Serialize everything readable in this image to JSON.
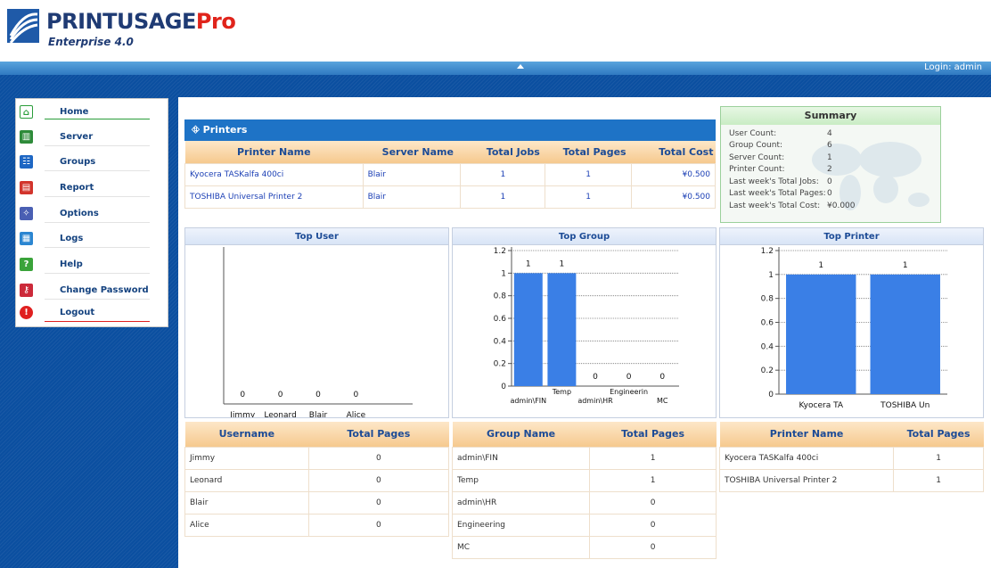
{
  "brand": {
    "name_main": "PRINTUSAGE",
    "name_pro": "Pro",
    "edition": "Enterprise 4.0"
  },
  "topbar": {
    "login": "Login: admin"
  },
  "menu": [
    {
      "label": "Home",
      "icon": "home-icon",
      "color": "#2a9d3a"
    },
    {
      "label": "Server",
      "icon": "server-icon",
      "color": "#2e8b3a"
    },
    {
      "label": "Groups",
      "icon": "groups-icon",
      "color": "#1e67c4"
    },
    {
      "label": "Report",
      "icon": "report-icon",
      "color": "#d2342c"
    },
    {
      "label": "Options",
      "icon": "options-icon",
      "color": "#4a5fb3"
    },
    {
      "label": "Logs",
      "icon": "logs-icon",
      "color": "#2b86d1"
    },
    {
      "label": "Help",
      "icon": "help-icon",
      "color": "#3aa33a"
    },
    {
      "label": "Change Password",
      "icon": "key-icon",
      "color": "#cc2a3a"
    },
    {
      "label": "Logout",
      "icon": "logout-icon",
      "color": "#e02020"
    }
  ],
  "printers": {
    "title": "Printers",
    "headers": [
      "Printer Name",
      "Server Name",
      "Total Jobs",
      "Total Pages",
      "Total Cost"
    ],
    "rows": [
      [
        "Kyocera TASKalfa 400ci",
        "Blair",
        "1",
        "1",
        "¥0.500"
      ],
      [
        "TOSHIBA Universal Printer 2",
        "Blair",
        "1",
        "1",
        "¥0.500"
      ]
    ]
  },
  "summary": {
    "title": "Summary",
    "items": [
      {
        "label": "User Count:",
        "value": "4"
      },
      {
        "label": "Group Count:",
        "value": "6"
      },
      {
        "label": "Server Count:",
        "value": "1"
      },
      {
        "label": "Printer Count:",
        "value": "2"
      },
      {
        "label": "Last week's Total Jobs:",
        "value": "0"
      },
      {
        "label": "Last week's Total Pages:",
        "value": "0"
      },
      {
        "label": "Last week's Total Cost:",
        "value": "¥0.000"
      }
    ]
  },
  "chart_data": [
    {
      "type": "bar",
      "title": "Top User",
      "categories": [
        "Jimmy",
        "Leonard",
        "Blair",
        "Alice"
      ],
      "values": [
        0,
        0,
        0,
        0
      ]
    },
    {
      "type": "bar",
      "title": "Top Group",
      "categories": [
        "admin\\FIN",
        "Temp",
        "admin\\HR",
        "Engineerin",
        "MC"
      ],
      "values": [
        1,
        1,
        0,
        0,
        0
      ],
      "ylim": [
        0,
        1.2
      ],
      "yticks": [
        "0",
        "0.2",
        "0.4",
        "0.6",
        "0.8",
        "1",
        "1.2"
      ],
      "grid": true
    },
    {
      "type": "bar",
      "title": "Top Printer",
      "categories": [
        "Kyocera TA",
        "TOSHIBA Un"
      ],
      "values": [
        1,
        1
      ],
      "ylim": [
        0,
        1.2
      ],
      "yticks": [
        "0",
        "0.2",
        "0.4",
        "0.6",
        "0.8",
        "1",
        "1.2"
      ],
      "grid": true
    }
  ],
  "user_table": {
    "headers": [
      "Username",
      "Total Pages"
    ],
    "rows": [
      [
        "Jimmy",
        "0"
      ],
      [
        "Leonard",
        "0"
      ],
      [
        "Blair",
        "0"
      ],
      [
        "Alice",
        "0"
      ]
    ]
  },
  "group_table": {
    "headers": [
      "Group Name",
      "Total Pages"
    ],
    "rows": [
      [
        "admin\\FIN",
        "1"
      ],
      [
        "Temp",
        "1"
      ],
      [
        "admin\\HR",
        "0"
      ],
      [
        "Engineering",
        "0"
      ],
      [
        "MC",
        "0"
      ]
    ]
  },
  "printer_table": {
    "headers": [
      "Printer Name",
      "Total Pages"
    ],
    "rows": [
      [
        "Kyocera TASKalfa 400ci",
        "1"
      ],
      [
        "TOSHIBA Universal Printer 2",
        "1"
      ]
    ]
  },
  "colors": {
    "bar": "#3a7fe6",
    "header_blue": "#1e73c6",
    "nav_blue": "#0b4fa0"
  }
}
